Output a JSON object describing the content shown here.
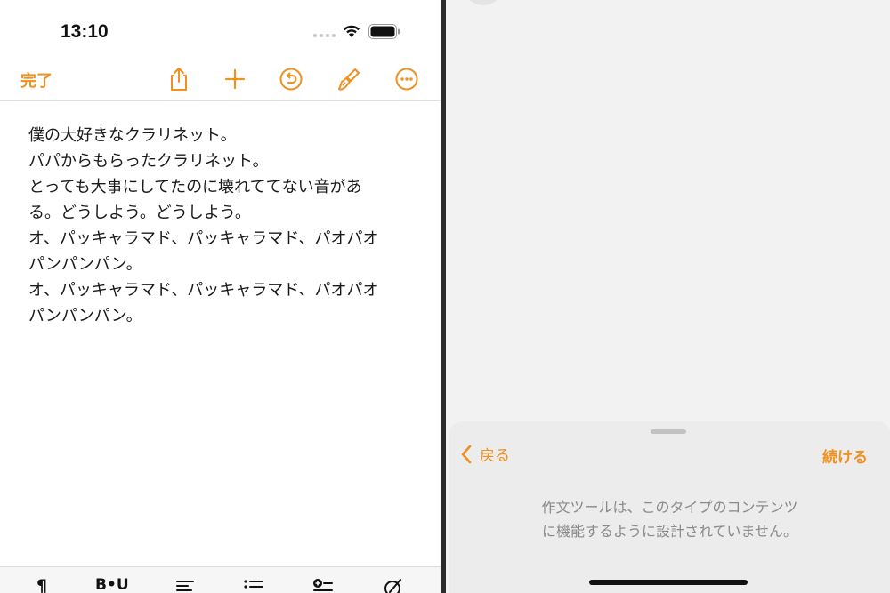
{
  "status_bar": {
    "time": "13:10"
  },
  "editor": {
    "done_label": "完了",
    "toolbar_icons": [
      "share-icon",
      "plus-icon",
      "undo-icon",
      "brush-icon",
      "more-icon"
    ],
    "document_lines": [
      "僕の大好きなクラリネット。",
      "パパからもらったクラリネット。",
      "とっても大事にしてたのに壊れててない音があ",
      "る。どうしよう。どうしよう。",
      "オ、パッキャラマド、パッキャラマド、パオパオ",
      "パンパンパン。",
      "オ、パッキャラマド、パッキャラマド、パオパオ",
      "パンパンパン。"
    ],
    "format_toolbar": {
      "paragraph_glyph": "¶",
      "text_style_glyph": "B•U",
      "icons": [
        "paragraph-icon",
        "text-style-icon",
        "align-icon",
        "list-icon",
        "insert-icon",
        "markup-icon"
      ]
    }
  },
  "writing_tools_sheet": {
    "back_label": "戻る",
    "continue_label": "続ける",
    "message_line1": "作文ツールは、このタイプのコンテンツ",
    "message_line2": "に機能するように設計されていません。"
  },
  "colors": {
    "accent": "#f0901e",
    "sheet_bg": "#ececec",
    "message_text": "#8a8a8a"
  }
}
